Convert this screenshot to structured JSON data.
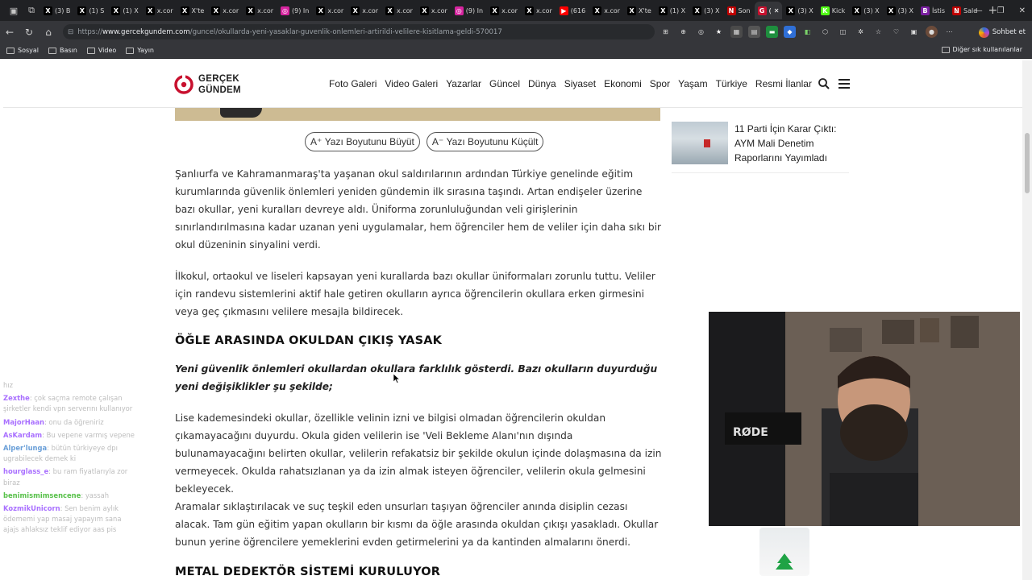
{
  "browser": {
    "tabs": [
      {
        "label": "(3) B",
        "icon": "x",
        "color": "#000000"
      },
      {
        "label": "(1) S",
        "icon": "x",
        "color": "#000000"
      },
      {
        "label": "(1) X",
        "icon": "x",
        "color": "#000000"
      },
      {
        "label": "x.cor",
        "icon": "x",
        "color": "#000000"
      },
      {
        "label": "X'te",
        "icon": "x",
        "color": "#000000"
      },
      {
        "label": "x.cor",
        "icon": "x",
        "color": "#000000"
      },
      {
        "label": "x.cor",
        "icon": "x",
        "color": "#000000"
      },
      {
        "label": "(9) In",
        "icon": "instagram",
        "color": "#d6249f"
      },
      {
        "label": "x.cor",
        "icon": "x",
        "color": "#000000"
      },
      {
        "label": "x.cor",
        "icon": "x",
        "color": "#000000"
      },
      {
        "label": "x.cor",
        "icon": "x",
        "color": "#000000"
      },
      {
        "label": "x.cor",
        "icon": "x",
        "color": "#000000"
      },
      {
        "label": "(9) In",
        "icon": "instagram",
        "color": "#d6249f"
      },
      {
        "label": "x.cor",
        "icon": "x",
        "color": "#000000"
      },
      {
        "label": "x.cor",
        "icon": "x",
        "color": "#000000"
      },
      {
        "label": "(616",
        "icon": "youtube",
        "color": "#ff0000"
      },
      {
        "label": "x.cor",
        "icon": "x",
        "color": "#000000"
      },
      {
        "label": "X'te",
        "icon": "x",
        "color": "#000000"
      },
      {
        "label": "(1) X",
        "icon": "x",
        "color": "#000000"
      },
      {
        "label": "(3) X",
        "icon": "x",
        "color": "#000000"
      },
      {
        "label": "Son",
        "icon": "news",
        "color": "#c00000"
      },
      {
        "label": "(",
        "icon": "gercekgundem",
        "color": "#c8102e",
        "active": true
      },
      {
        "label": "(3) X",
        "icon": "x",
        "color": "#000000"
      },
      {
        "label": "Kick",
        "icon": "kick",
        "color": "#53fc18"
      },
      {
        "label": "(3) X",
        "icon": "x",
        "color": "#000000"
      },
      {
        "label": "(3) X",
        "icon": "x",
        "color": "#000000"
      },
      {
        "label": "İstis",
        "icon": "b",
        "color": "#7b1fa2"
      },
      {
        "label": "Sald",
        "icon": "news",
        "color": "#c00000"
      }
    ],
    "url_scheme": "https://",
    "url_host": "www.gercekgundem.com",
    "url_path": "/guncel/okullarda-yeni-yasaklar-guvenlik-onlemleri-artirildi-velilere-kisitlama-geldi-570017",
    "chat_button": "Sohbet et",
    "bookmarks": [
      "Sosyal",
      "Basın",
      "Video",
      "Yayın"
    ],
    "other_bookmarks": "Diğer sık kullanılanlar"
  },
  "site": {
    "logo_line1": "GERÇEK",
    "logo_line2": "GÜNDEM",
    "brand_color": "#c8102e",
    "nav": [
      "Foto Galeri",
      "Video Galeri",
      "Yazarlar",
      "Güncel",
      "Dünya",
      "Siyaset",
      "Ekonomi",
      "Spor",
      "Yaşam",
      "Türkiye",
      "Resmi İlanlar"
    ]
  },
  "article": {
    "font_increase": "Yazı Boyutunu Büyüt",
    "font_decrease": "Yazı Boyutunu Küçült",
    "font_increase_prefix": "A⁺",
    "font_decrease_prefix": "A⁻",
    "para1": "Şanlıurfa ve Kahramanmaraş'ta yaşanan okul saldırılarının ardından Türkiye genelinde eğitim kurumlarında güvenlik önlemleri yeniden gündemin ilk sırasına taşındı. Artan endişeler üzerine bazı okullar, yeni kuralları devreye aldı. Üniforma zorunluluğundan veli girişlerinin sınırlandırılmasına kadar uzanan yeni uygulamalar, hem öğrenciler hem de veliler için daha sıkı bir okul düzeninin sinyalini verdi.",
    "para2": "İlkokul, ortaokul ve liseleri kapsayan yeni kurallarda bazı okullar üniformaları zorunlu tuttu. Veliler için randevu sistemlerini aktif hale getiren okulların ayrıca öğrencilerin okullara erken girmesini veya geç çıkmasını velilere mesajla bildirecek.",
    "heading1": "ÖĞLE ARASINDA OKULDAN ÇIKIŞ YASAK",
    "lead": "Yeni güvenlik önlemleri okullardan okullara farklılık gösterdi. Bazı okulların duyurduğu yeni değişiklikler şu şekilde;",
    "para3": "Lise kademesindeki okullar, özellikle velinin izni ve bilgisi olmadan öğrencilerin okuldan çıkamayacağını duyurdu. Okula giden velilerin ise 'Veli Bekleme Alanı'nın dışında bulunamayacağını belirten okullar, velilerin refakatsiz bir şekilde okulun içinde dolaşmasına da izin vermeyecek. Okulda rahatsızlanan ya da izin almak isteyen öğrenciler, velilerin okula gelmesini bekleyecek.",
    "para4": "Aramalar sıklaştırılacak ve suç teşkil eden unsurları taşıyan öğrenciler anında disiplin cezası alacak. Tam gün eğitim yapan okulların bir kısmı da öğle arasında okuldan çıkışı yasakladı. Okullar bunun yerine öğrencilere yemeklerini evden getirmelerini ya da kantinden almalarını önerdi.",
    "heading2": "METAL DEDEKTÖR SİSTEMİ KURULUYOR"
  },
  "sidebar": {
    "card_title": "11 Parti İçin Karar Çıktı: AYM Mali Denetim Raporlarını Yayımladı"
  },
  "stream_chat": [
    {
      "user": "",
      "text": "hız",
      "color": "#cfcfcf"
    },
    {
      "user": "Zexthe",
      "text": "çok saçma remote çalışan şirketler kendi vpn serverını kullanıyor",
      "color": "#a970ff"
    },
    {
      "user": "MajorHaan",
      "text": "onu da öğreniriz",
      "color": "#a970ff"
    },
    {
      "user": "AsKardam",
      "text": "Bu vepene varmış vepene",
      "color": "#a970ff"
    },
    {
      "user": "Alper'lunga",
      "text": "bütün türkiyeye dpı ugrabilecek demek ki",
      "color": "#6a9fd8"
    },
    {
      "user": "hourglass_e",
      "text": "bu ram fiyatlarıyla zor biraz",
      "color": "#a970ff"
    },
    {
      "user": "benimismimsencene",
      "text": "yassah",
      "color": "#58c14a"
    },
    {
      "user": "KozmikUnicorn",
      "text": "Sen benim aylık ödememi yap masaj yapayım sana ajajs ahlaksız teklif ediyor aas pis",
      "color": "#a970ff"
    }
  ],
  "overlay": {
    "cam_label": "RØDE"
  }
}
